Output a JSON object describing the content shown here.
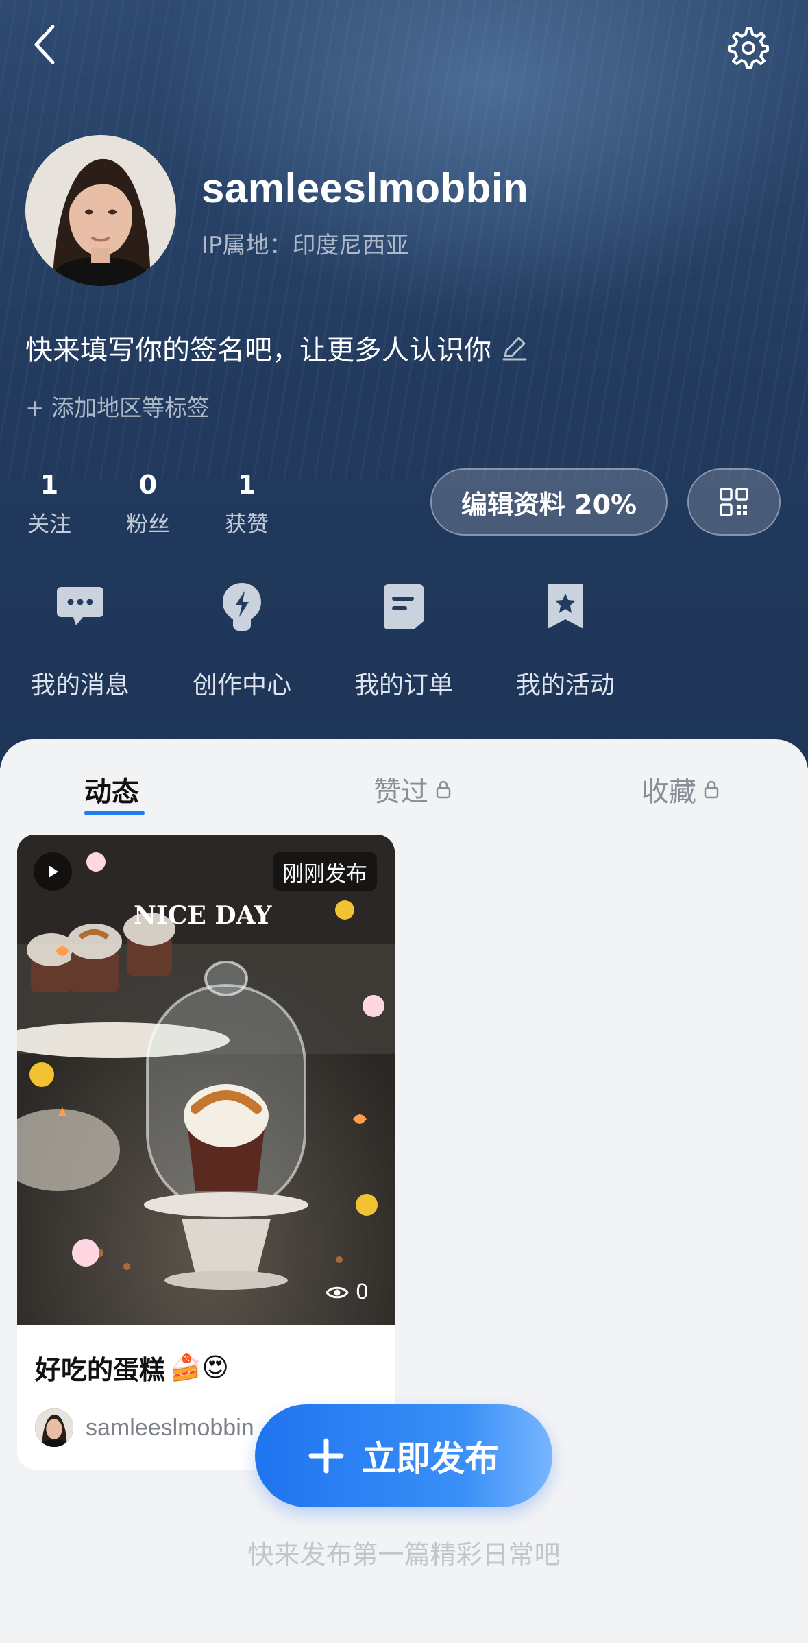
{
  "profile": {
    "username": "samleeslmobbin",
    "ip_location": "IP属地：印度尼西亚",
    "bio": "快来填写你的签名吧，让更多人认识你",
    "add_tags": "+ 添加地区等标签"
  },
  "stats": [
    {
      "value": "1",
      "label": "关注"
    },
    {
      "value": "0",
      "label": "粉丝"
    },
    {
      "value": "1",
      "label": "获赞"
    }
  ],
  "edit_profile_label": "编辑资料 20%",
  "shortcuts": [
    {
      "label": "我的消息",
      "icon": "message-icon"
    },
    {
      "label": "创作中心",
      "icon": "creator-icon"
    },
    {
      "label": "我的订单",
      "icon": "order-icon"
    },
    {
      "label": "我的活动",
      "icon": "activity-icon"
    }
  ],
  "tabs": [
    {
      "label": "动态",
      "active": true
    },
    {
      "label": "赞过",
      "locked": true
    },
    {
      "label": "收藏",
      "locked": true
    }
  ],
  "post": {
    "badge": "刚刚发布",
    "image_text": "NICE DAY",
    "views": "0",
    "title": "好吃的蛋糕",
    "title_emojis": "🍰😍",
    "author": "samleeslmobbin"
  },
  "publish_button": "立即发布",
  "empty_hint": "快来发布第一篇精彩日常吧",
  "colors": {
    "accent": "#1e7cf2",
    "header_bg": "#223b5f"
  }
}
